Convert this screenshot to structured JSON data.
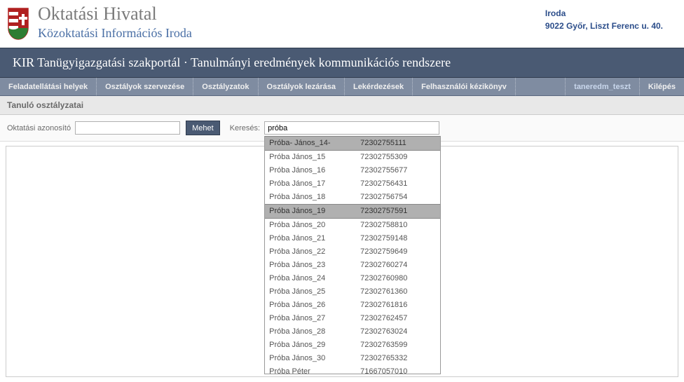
{
  "header": {
    "title": "Oktatási Hivatal",
    "subtitle": "Közoktatási Információs Iroda",
    "org_name": "Iroda",
    "org_address": "9022 Győr, Liszt Ferenc u. 40."
  },
  "portal_title": "KIR Tanügyigazgatási szakportál · Tanulmányi eredmények kommunikációs rendszere",
  "nav": {
    "items": [
      "Feladatellátási helyek",
      "Osztályok szervezése",
      "Osztályzatok",
      "Osztályok lezárása",
      "Lekérdezések",
      "Felhasználói kézikönyv"
    ],
    "user": "taneredm_teszt",
    "logout": "Kilépés"
  },
  "section_title": "Tanuló osztályzatai",
  "filters": {
    "id_label": "Oktatási azonosító",
    "id_value": "",
    "go_label": "Mehet",
    "search_label": "Keresés:",
    "search_value": "próba"
  },
  "dropdown": {
    "selected_indices": [
      0,
      5
    ],
    "rows": [
      {
        "name": "Próba- János_14-",
        "id": "72302755111"
      },
      {
        "name": "Próba János_15",
        "id": "72302755309"
      },
      {
        "name": "Próba János_16",
        "id": "72302755677"
      },
      {
        "name": "Próba János_17",
        "id": "72302756431"
      },
      {
        "name": "Próba János_18",
        "id": "72302756754"
      },
      {
        "name": "Próba János_19",
        "id": "72302757591"
      },
      {
        "name": "Próba János_20",
        "id": "72302758810"
      },
      {
        "name": "Próba János_21",
        "id": "72302759148"
      },
      {
        "name": "Próba János_22",
        "id": "72302759649"
      },
      {
        "name": "Próba János_23",
        "id": "72302760274"
      },
      {
        "name": "Próba János_24",
        "id": "72302760980"
      },
      {
        "name": "Próba János_25",
        "id": "72302761360"
      },
      {
        "name": "Próba János_26",
        "id": "72302761816"
      },
      {
        "name": "Próba János_27",
        "id": "72302762457"
      },
      {
        "name": "Próba János_28",
        "id": "72302763024"
      },
      {
        "name": "Próba János_29",
        "id": "72302763599"
      },
      {
        "name": "Próba János_30",
        "id": "72302765332"
      },
      {
        "name": "Próba Péter",
        "id": "71667057010"
      }
    ]
  }
}
